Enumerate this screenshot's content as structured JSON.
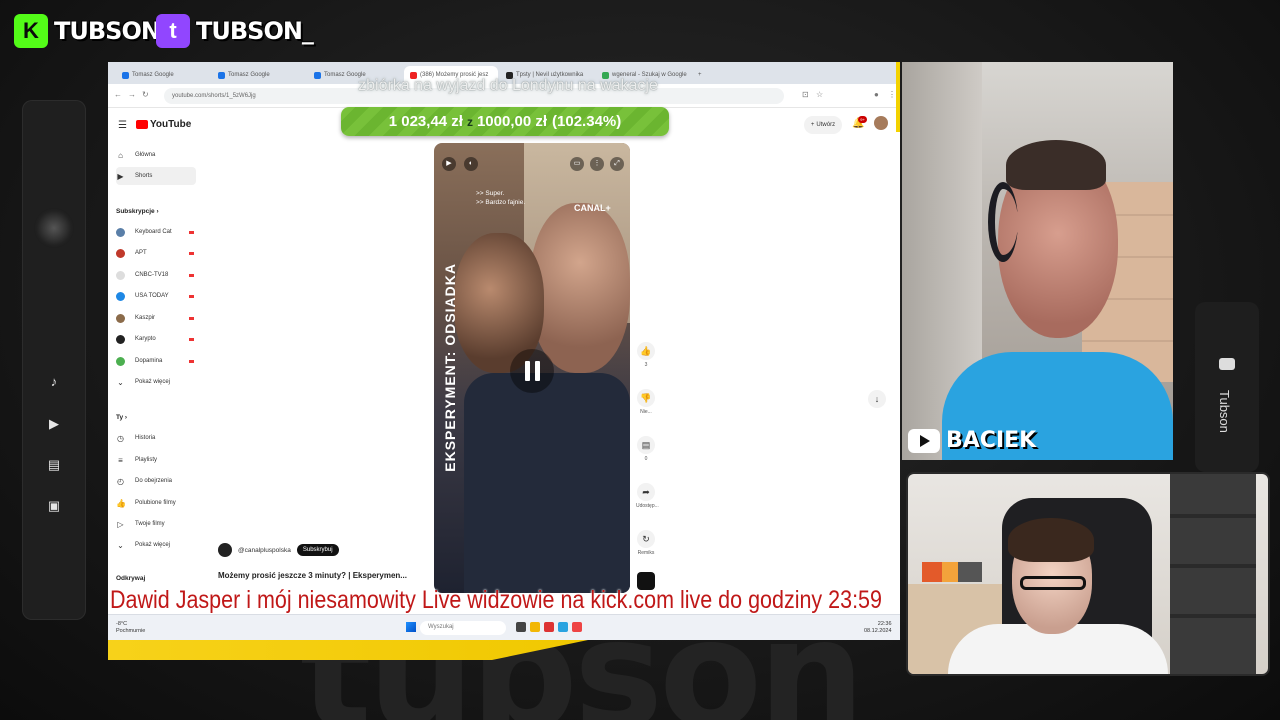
{
  "overlay": {
    "brands": [
      {
        "platform": "kick",
        "logo_letter": "K",
        "name": "TUBSON",
        "color": "#53fc18"
      },
      {
        "platform": "twitch",
        "logo_letter": "t",
        "name": "TUBSON_",
        "color": "#9146ff"
      }
    ],
    "background_word": "tubson",
    "right_dock_label": "Tubson",
    "ticker_text": "Dawid Jasper i mój niesamowity Live widzowie na    kick.com  live do godziny 23:59",
    "donation_heading": "zbiórka na wyjazd do Londynu na wakacje",
    "goal": {
      "current": "1 023,44 zł",
      "separator": "z",
      "target": "1000,00 zł",
      "percent": "(102.34%)",
      "progress_fraction": 1.0234,
      "color": "#78c13a"
    },
    "cam_label": "BACIEK"
  },
  "browser": {
    "tabs": [
      {
        "label": "Tomasz Google"
      },
      {
        "label": "Tomasz Google"
      },
      {
        "label": "Tomasz Google"
      },
      {
        "label": "(386) Możemy prosić jesz"
      },
      {
        "label": "Tpsty | Nevil użytkownika"
      },
      {
        "label": "wgeneral - Szukaj w Google"
      }
    ],
    "url": "youtube.com/shorts/1_5zW6Jjg",
    "taskbar": {
      "search_placeholder": "Wyszukaj",
      "weather": "-8°C",
      "weather_sub": "Pochmurnie",
      "time": "22:36",
      "date": "08.12.2024"
    }
  },
  "youtube": {
    "logo_text": "YouTube",
    "create_label": "Utwórz",
    "notification_count": "9+",
    "sidebar": {
      "top": [
        {
          "label": "Główna",
          "icon": "home-icon"
        },
        {
          "label": "Shorts",
          "icon": "shorts-icon"
        }
      ],
      "subscriptions_heading": "Subskrypcje",
      "subscriptions": [
        {
          "label": "Keyboard Cat",
          "color": "#5a7fa8"
        },
        {
          "label": "APT",
          "color": "#c0392b"
        },
        {
          "label": "CNBC-TV18",
          "color": "#e5e5e5"
        },
        {
          "label": "USA TODAY",
          "color": "#1e88e5"
        },
        {
          "label": "Kaszpir",
          "color": "#8b6b4a"
        },
        {
          "label": "Karypto",
          "color": "#222222"
        },
        {
          "label": "Dopamina",
          "color": "#4caf50"
        }
      ],
      "show_more_1": "Pokaż więcej",
      "you_heading": "Ty",
      "you_items": [
        {
          "label": "Historia",
          "icon": "history-icon"
        },
        {
          "label": "Playlisty",
          "icon": "playlist-icon"
        },
        {
          "label": "Do obejrzenia",
          "icon": "watch-later-icon"
        },
        {
          "label": "Polubione filmy",
          "icon": "like-icon"
        },
        {
          "label": "Twoje filmy",
          "icon": "your-videos-icon"
        }
      ],
      "show_more_2": "Pokaż więcej",
      "explore_heading": "Odkrywaj"
    },
    "short": {
      "vertical_title": "EKSPERYMENT: ODSIADKA",
      "subtitle_line1": ">> Super.",
      "subtitle_line2": ">> Bardzo fajnie.",
      "watermark": "CANAL+",
      "channel_handle": "@canalpluspolska",
      "subscribe_label": "Subskrybuj",
      "title": "Możemy prosić jeszcze 3 minuty? | Eksperymen...",
      "actions": [
        {
          "icon": "like-icon",
          "count": "3"
        },
        {
          "icon": "dislike-icon",
          "count": "Nie..."
        },
        {
          "icon": "comments-icon",
          "count": "0"
        },
        {
          "icon": "share-icon",
          "count": "Udostęp..."
        },
        {
          "icon": "remix-icon",
          "count": "Remiks"
        }
      ]
    }
  }
}
